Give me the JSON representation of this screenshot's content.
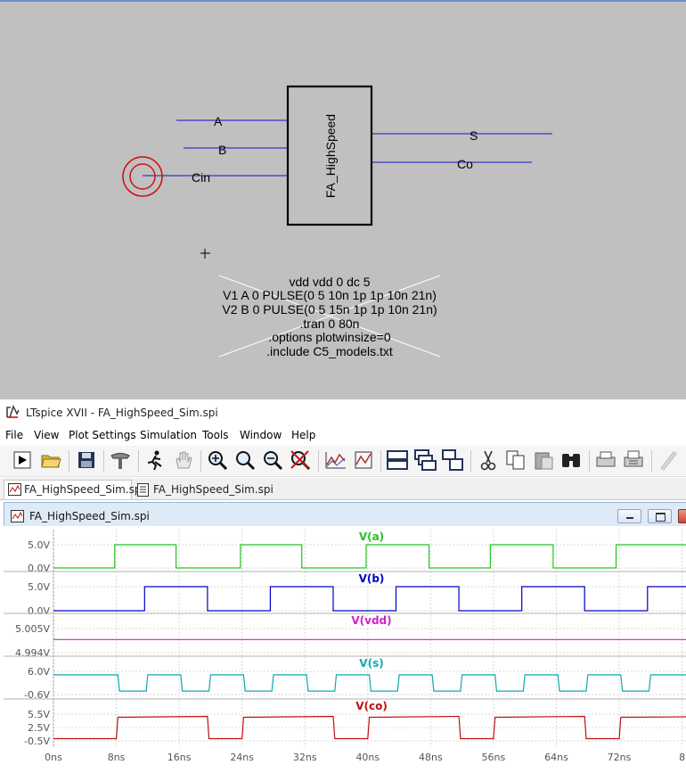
{
  "schematic": {
    "component_label": "FA_HighSpeed",
    "pins": {
      "a": "A",
      "b": "B",
      "cin": "Cin",
      "s": "S",
      "co": "Co"
    },
    "directives": [
      "vdd vdd 0 dc 5",
      "V1 A 0 PULSE(0 5 10n 1p 1p 10n 21n)",
      "V2 B 0 PULSE(0 5 15n 1p 1p 10n 21n)",
      ".tran 0 80n",
      ".options plotwinsize=0",
      ".include C5_models.txt"
    ]
  },
  "window": {
    "title": "LTspice XVII - FA_HighSpeed_Sim.spi"
  },
  "menu": [
    "File",
    "View",
    "Plot Settings",
    "Simulation",
    "Tools",
    "Window",
    "Help"
  ],
  "toolbar_icons": [
    "run-icon",
    "open-icon",
    "save-icon",
    "control-panel-icon",
    "halt-icon",
    "pan-icon",
    "zoom-in-icon",
    "zoom-full-icon",
    "zoom-out-icon",
    "zoom-cancel-icon",
    "autorange-icon",
    "manual-limits-icon",
    "tile-horizontal-icon",
    "cascade-icon",
    "tile-vertical-icon",
    "cut-icon",
    "copy-icon",
    "paste-icon",
    "find-icon",
    "print-preview-icon",
    "print-icon",
    "edit-icon"
  ],
  "tabs": [
    {
      "label": "FA_HighSpeed_Sim.spi",
      "icon": "waveform-icon",
      "active": true
    },
    {
      "label": "FA_HighSpeed_Sim.spi",
      "icon": "netlist-icon",
      "active": false
    }
  ],
  "plot_window": {
    "title": "FA_HighSpeed_Sim.spi"
  },
  "chart_data": {
    "type": "line",
    "xlabel": "",
    "x_ticks": [
      "0ns",
      "8ns",
      "16ns",
      "24ns",
      "32ns",
      "40ns",
      "48ns",
      "56ns",
      "64ns",
      "72ns",
      "8"
    ],
    "xlim_ns": [
      0,
      80.5
    ],
    "colors": {
      "a": "#22c322",
      "b": "#0000c8",
      "vdd": "#d020c8",
      "s": "#10a8b0",
      "co": "#c01010",
      "grid": "#d8d8d8"
    },
    "panes": [
      {
        "name": "V(a)",
        "color": "#22c322",
        "y_ticks": [
          "5.0V",
          "0.0V"
        ],
        "ylim": [
          0,
          5
        ],
        "points": [
          [
            0,
            0
          ],
          [
            7.8,
            0
          ],
          [
            7.8,
            5
          ],
          [
            15.6,
            5
          ],
          [
            15.6,
            0
          ],
          [
            23.8,
            0
          ],
          [
            23.8,
            5
          ],
          [
            31.6,
            5
          ],
          [
            31.6,
            0
          ],
          [
            39.8,
            0
          ],
          [
            39.8,
            5
          ],
          [
            47.8,
            5
          ],
          [
            47.8,
            0
          ],
          [
            55.6,
            0
          ],
          [
            55.6,
            5
          ],
          [
            63.6,
            5
          ],
          [
            63.6,
            0
          ],
          [
            71.6,
            0
          ],
          [
            71.6,
            5
          ],
          [
            80.5,
            5
          ]
        ]
      },
      {
        "name": "V(b)",
        "color": "#0000c8",
        "y_ticks": [
          "5.0V",
          "0.0V"
        ],
        "ylim": [
          0,
          5
        ],
        "points": [
          [
            0,
            0
          ],
          [
            11.6,
            0
          ],
          [
            11.6,
            5
          ],
          [
            19.6,
            5
          ],
          [
            19.6,
            0
          ],
          [
            27.6,
            0
          ],
          [
            27.6,
            5
          ],
          [
            35.6,
            5
          ],
          [
            35.6,
            0
          ],
          [
            43.6,
            0
          ],
          [
            43.6,
            5
          ],
          [
            51.6,
            5
          ],
          [
            51.6,
            0
          ],
          [
            59.6,
            0
          ],
          [
            59.6,
            5
          ],
          [
            67.6,
            5
          ],
          [
            67.6,
            0
          ],
          [
            75.6,
            0
          ],
          [
            75.6,
            5
          ],
          [
            80.5,
            5
          ]
        ]
      },
      {
        "name": "V(vdd)",
        "color": "#d020c8",
        "y_ticks": [
          "5.005V",
          "4.994V"
        ],
        "ylim": [
          4.994,
          5.005
        ],
        "points": [
          [
            0,
            5.0
          ],
          [
            80.5,
            5.0
          ]
        ]
      },
      {
        "name": "V(s)",
        "color": "#10a8b0",
        "y_ticks": [
          "6.0V",
          "-0.6V"
        ],
        "ylim": [
          -0.6,
          6.0
        ],
        "points": [
          [
            0,
            5.0
          ],
          [
            8.2,
            5.0
          ],
          [
            8.4,
            0.4
          ],
          [
            11.8,
            0.4
          ],
          [
            12.0,
            5.0
          ],
          [
            16.2,
            5.0
          ],
          [
            16.4,
            0.4
          ],
          [
            19.8,
            0.4
          ],
          [
            20.0,
            5.0
          ],
          [
            24.2,
            5.0
          ],
          [
            24.4,
            0.4
          ],
          [
            27.8,
            0.4
          ],
          [
            28.0,
            5.0
          ],
          [
            32.2,
            5.0
          ],
          [
            32.4,
            0.4
          ],
          [
            35.8,
            0.4
          ],
          [
            36.0,
            5.0
          ],
          [
            40.2,
            5.0
          ],
          [
            40.4,
            0.4
          ],
          [
            43.8,
            0.4
          ],
          [
            44.0,
            5.0
          ],
          [
            48.2,
            5.0
          ],
          [
            48.4,
            0.4
          ],
          [
            51.8,
            0.4
          ],
          [
            52.0,
            5.0
          ],
          [
            56.2,
            5.0
          ],
          [
            56.4,
            0.4
          ],
          [
            59.8,
            0.4
          ],
          [
            60.0,
            5.0
          ],
          [
            64.2,
            5.0
          ],
          [
            64.4,
            0.4
          ],
          [
            67.8,
            0.4
          ],
          [
            68.0,
            5.0
          ],
          [
            72.2,
            5.0
          ],
          [
            72.4,
            0.4
          ],
          [
            75.8,
            0.4
          ],
          [
            76.0,
            5.0
          ],
          [
            80.5,
            5.0
          ]
        ]
      },
      {
        "name": "V(co)",
        "color": "#c01010",
        "y_ticks": [
          "5.5V",
          "2.5V",
          "-0.5V"
        ],
        "ylim": [
          -0.5,
          5.5
        ],
        "points": [
          [
            0,
            0
          ],
          [
            8.0,
            0
          ],
          [
            8.2,
            4.8
          ],
          [
            19.6,
            5.0
          ],
          [
            19.8,
            0
          ],
          [
            24.0,
            0
          ],
          [
            24.2,
            4.8
          ],
          [
            35.6,
            5.0
          ],
          [
            35.8,
            0
          ],
          [
            40.0,
            0
          ],
          [
            40.2,
            4.8
          ],
          [
            51.6,
            5.0
          ],
          [
            51.8,
            0
          ],
          [
            56.0,
            0
          ],
          [
            56.2,
            4.8
          ],
          [
            67.6,
            5.0
          ],
          [
            67.8,
            0
          ],
          [
            72.0,
            0
          ],
          [
            72.2,
            4.8
          ],
          [
            80.5,
            4.9
          ]
        ]
      }
    ]
  }
}
